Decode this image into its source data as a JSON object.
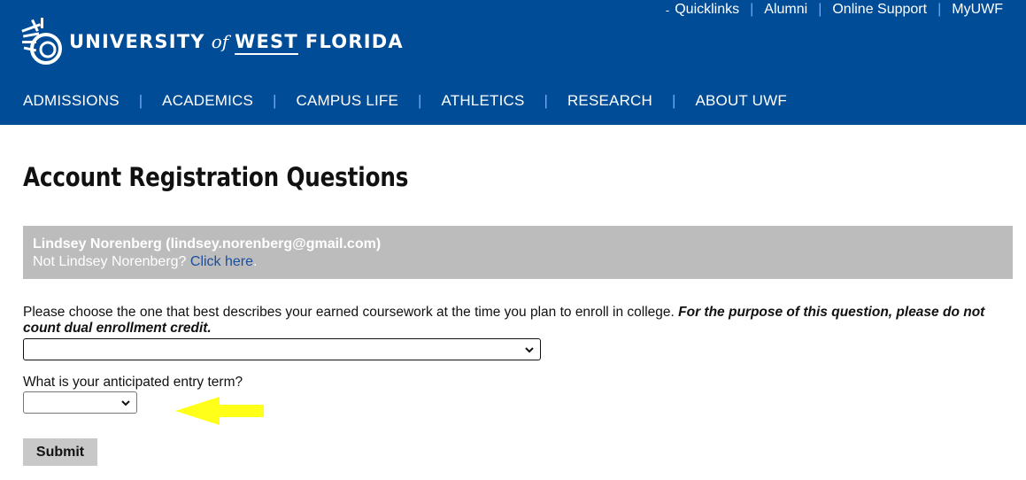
{
  "header": {
    "logo": {
      "word1": "UNIVERSITY",
      "word2": "of",
      "word3": "WEST",
      "word4": "FLORIDA"
    },
    "quicklinks_prefix": "-",
    "quicklinks": [
      "Quicklinks",
      "Alumni",
      "Online Support",
      "MyUWF"
    ],
    "nav": [
      "ADMISSIONS",
      "ACADEMICS",
      "CAMPUS LIFE",
      "ATHLETICS",
      "RESEARCH",
      "ABOUT UWF"
    ]
  },
  "page": {
    "title": "Account Registration Questions",
    "user_box": {
      "name_line": "Lindsey Norenberg (lindsey.norenberg@gmail.com)",
      "not_user_text": "Not Lindsey Norenberg?",
      "click_here": "Click here",
      "period": "."
    },
    "question1": {
      "text": "Please choose the one that best describes your earned coursework at the time you plan to enroll in college.",
      "emphasis": "For the purpose of this question, please do not count dual enrollment credit.",
      "selected": ""
    },
    "question2": {
      "text": "What is your anticipated entry term?",
      "selected": ""
    },
    "submit_label": "Submit"
  },
  "colors": {
    "header_bg": "#004c97",
    "separator": "#6fa8ff",
    "user_box_bg": "#bcbcbc",
    "link": "#1b4fa0",
    "annotation_arrow": "#ffff1a"
  },
  "icons": {
    "logo": "uwf-shell-logo-icon",
    "select_caret": "chevron-down-icon",
    "annotation": "left-arrow-icon"
  }
}
